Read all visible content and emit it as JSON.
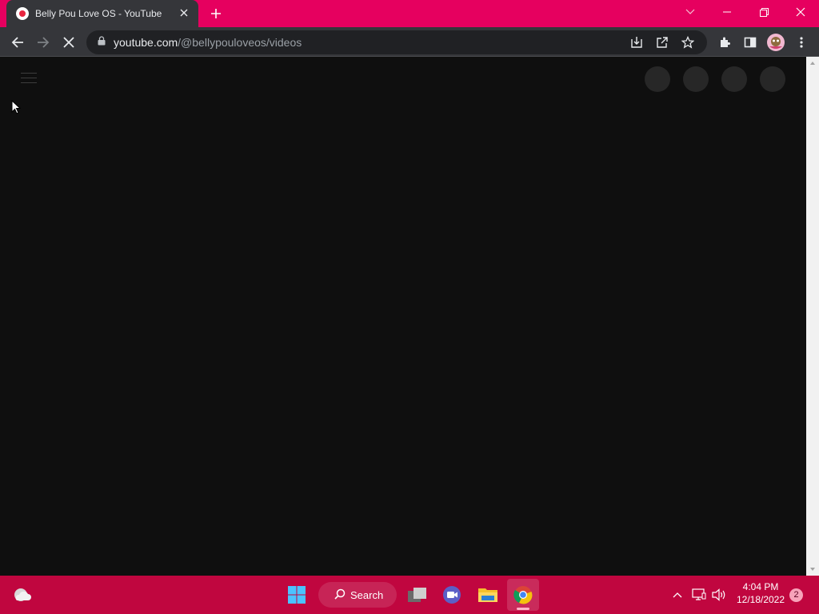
{
  "browser": {
    "tab_title": "Belly Pou Love OS - YouTube",
    "url_host": "youtube.com",
    "url_path": "/@bellypouloveos/videos",
    "accent_color": "#e6005f"
  },
  "page": {
    "state": "loading",
    "background": "#0f0f0f"
  },
  "taskbar": {
    "search_label": "Search",
    "time": "4:04 PM",
    "date": "12/18/2022",
    "notification_count": "2",
    "color": "#c0063f"
  },
  "icons": {
    "tab": [
      "youtube-favicon",
      "close-icon",
      "new-tab-icon"
    ],
    "window": [
      "tab-search-icon",
      "minimize-icon",
      "restore-icon",
      "window-close-icon"
    ],
    "toolbar": [
      "back-icon",
      "forward-icon",
      "stop-loading-icon",
      "lock-icon",
      "install-app-icon",
      "share-icon",
      "bookmark-star-icon",
      "extensions-icon",
      "side-panel-icon",
      "profile-avatar",
      "menu-icon"
    ],
    "taskbar": [
      "weather-icon",
      "start-icon",
      "search-icon",
      "task-view-icon",
      "meet-icon",
      "file-explorer-icon",
      "chrome-icon",
      "tray-chevron-icon",
      "network-icon",
      "volume-icon"
    ]
  }
}
